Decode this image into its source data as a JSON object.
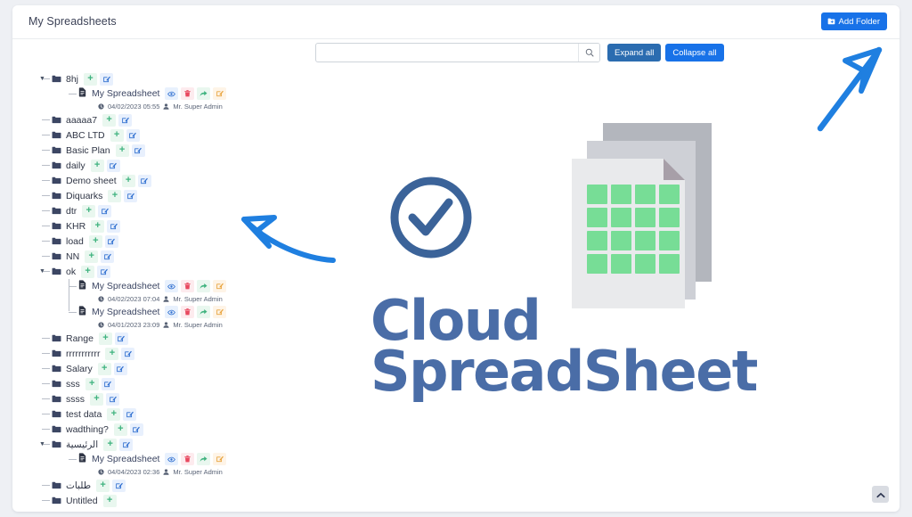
{
  "header": {
    "title": "My Spreadsheets",
    "add_folder_label": "Add Folder"
  },
  "toolbar": {
    "search_placeholder": "",
    "search_value": "",
    "expand_all_label": "Expand all",
    "collapse_all_label": "Collapse all"
  },
  "colors": {
    "accent_blue": "#1872e8",
    "expand_blue": "#2b6cb0",
    "brand_blue": "#4a6da7",
    "grid_green": "#77dd96",
    "annotation_blue": "#1f7fe0",
    "folder_icon": "#3c4663"
  },
  "brand": {
    "line1": "Cloud",
    "line2": "SpreadSheet"
  },
  "actions": {
    "add_title": "Add",
    "edit_title": "Edit",
    "view_title": "View",
    "delete_title": "Delete",
    "share_title": "Share",
    "rename_title": "Rename"
  },
  "tree": [
    {
      "name": "8hj",
      "expanded": true,
      "buttons": [
        "add",
        "edit"
      ],
      "children": [
        {
          "name": "My Spreadsheet",
          "date": "04/02/2023 05:55",
          "owner": "Mr. Super Admin",
          "buttons": [
            "view",
            "delete",
            "share",
            "edit2"
          ]
        }
      ]
    },
    {
      "name": "aaaaa7",
      "expanded": false,
      "buttons": [
        "add",
        "edit"
      ],
      "children": []
    },
    {
      "name": "ABC LTD",
      "expanded": false,
      "buttons": [
        "add",
        "edit"
      ],
      "children": []
    },
    {
      "name": "Basic Plan",
      "expanded": false,
      "buttons": [
        "add",
        "edit"
      ],
      "children": []
    },
    {
      "name": "daily",
      "expanded": false,
      "buttons": [
        "add",
        "edit"
      ],
      "children": []
    },
    {
      "name": "Demo sheet",
      "expanded": false,
      "buttons": [
        "add",
        "edit"
      ],
      "children": []
    },
    {
      "name": "Diquarks",
      "expanded": false,
      "buttons": [
        "add",
        "edit"
      ],
      "children": []
    },
    {
      "name": "dtr",
      "expanded": false,
      "buttons": [
        "add",
        "edit"
      ],
      "children": []
    },
    {
      "name": "KHR",
      "expanded": false,
      "buttons": [
        "add",
        "edit"
      ],
      "children": []
    },
    {
      "name": "load",
      "expanded": false,
      "buttons": [
        "add",
        "edit"
      ],
      "children": []
    },
    {
      "name": "NN",
      "expanded": false,
      "buttons": [
        "add",
        "edit"
      ],
      "children": []
    },
    {
      "name": "ok",
      "expanded": true,
      "buttons": [
        "add",
        "edit"
      ],
      "children": [
        {
          "name": "My Spreadsheet",
          "date": "04/02/2023 07:04",
          "owner": "Mr. Super Admin",
          "buttons": [
            "view",
            "delete",
            "share",
            "edit2"
          ]
        },
        {
          "name": "My Spreadsheet",
          "date": "04/01/2023 23:09",
          "owner": "Mr. Super Admin",
          "buttons": [
            "view",
            "delete",
            "share",
            "edit2"
          ]
        }
      ]
    },
    {
      "name": "Range",
      "expanded": false,
      "buttons": [
        "add",
        "edit"
      ],
      "children": []
    },
    {
      "name": "rrrrrrrrrrr",
      "expanded": false,
      "buttons": [
        "add",
        "edit"
      ],
      "children": []
    },
    {
      "name": "Salary",
      "expanded": false,
      "buttons": [
        "add",
        "edit"
      ],
      "children": []
    },
    {
      "name": "sss",
      "expanded": false,
      "buttons": [
        "add",
        "edit"
      ],
      "children": []
    },
    {
      "name": "ssss",
      "expanded": false,
      "buttons": [
        "add",
        "edit"
      ],
      "children": []
    },
    {
      "name": "test data",
      "expanded": false,
      "buttons": [
        "add",
        "edit"
      ],
      "children": []
    },
    {
      "name": "wadthing?",
      "expanded": false,
      "buttons": [
        "add",
        "edit"
      ],
      "children": []
    },
    {
      "name": "الرئيسية",
      "rtl": true,
      "expanded": true,
      "buttons": [
        "add",
        "edit"
      ],
      "children": [
        {
          "name": "My Spreadsheet",
          "date": "04/04/2023 02:36",
          "owner": "Mr. Super Admin",
          "buttons": [
            "view",
            "delete",
            "share",
            "edit2"
          ]
        }
      ]
    },
    {
      "name": "طلبات",
      "rtl": true,
      "expanded": false,
      "buttons": [
        "add",
        "edit"
      ],
      "children": []
    },
    {
      "name": "Untitled",
      "expanded": false,
      "buttons": [
        "add"
      ],
      "children": []
    }
  ],
  "illustration": {
    "check_icon": "check-circle-icon",
    "documents_icon": "spreadsheet-stack-icon",
    "grid_rows": 4,
    "grid_cols": 4
  },
  "annotations": [
    {
      "name": "arrow-to-add-folder",
      "direction": "up-right"
    },
    {
      "name": "arrow-to-tree",
      "direction": "up-left"
    }
  ],
  "scroll_top": {
    "label": "▲"
  }
}
